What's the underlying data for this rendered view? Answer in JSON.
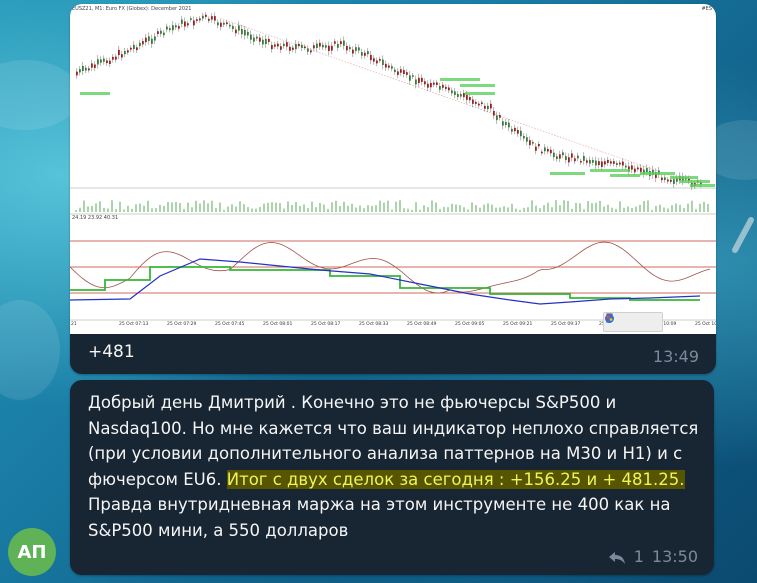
{
  "colors": {
    "bubble": "#182533",
    "text": "#f5f5f5",
    "meta": "#7b8a99",
    "highlight_bg": "#565600",
    "highlight_text": "#f2f25a",
    "avatar": "#5fb356"
  },
  "message1": {
    "chart_header_left": "EUSZ21, M1: Euro FX (Globex): December 2021",
    "chart_header_right": "#ES",
    "indicator_header": "24.19 23.92 40.31",
    "x_axis_labels": [
      "21",
      "25 Oct 07:13",
      "25 Oct 07:29",
      "25 Oct 07:45",
      "25 Oct 08:01",
      "25 Oct 08:17",
      "25 Oct 08:33",
      "25 Oct 08:49",
      "25 Oct 09:05",
      "25 Oct 09:21",
      "25 Oct 09:37",
      "25 Oct 09:53",
      "25 Oct 10:09",
      "25 Oct 10:25"
    ],
    "caption": "+481",
    "time": "13:49",
    "toolbar_icons": [
      "pencil-icon",
      "brush-icon",
      "color-picker-icon"
    ]
  },
  "message2": {
    "text_before": "Добрый день Дмитрий . Конечно это не фьючерсы  S&P500 и Nasdaq100. Но мне кажется что ваш индикатор неплохо справляется (при условии дополнительного анализа паттернов на М30 и Н1) и с фючерсом EU6. ",
    "text_highlight": "Итог с двух сделок за сегодня : +156.25 и + 481.25.",
    "text_after": " Правда внутридневная маржа на этом инструменте не 400 как на S&P500 мини, а 550 долларов",
    "reply_count": "1",
    "time": "13:50"
  },
  "avatar": {
    "initials": "АП"
  }
}
